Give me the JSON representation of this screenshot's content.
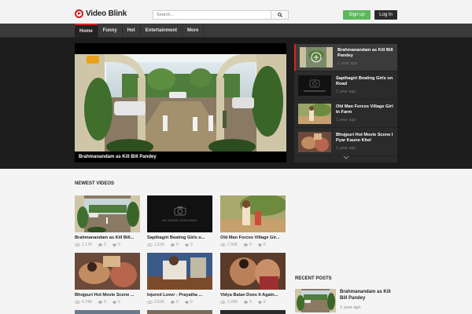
{
  "header": {
    "logo_text": "Video Blink",
    "search_placeholder": "Search...",
    "signup_label": "Sign up",
    "login_label": "Log In"
  },
  "nav": {
    "items": [
      "Home",
      "Funny",
      "Hot",
      "Entertainment",
      "More"
    ]
  },
  "player": {
    "title": "Brahmanandam as Kill Bill Pandey"
  },
  "playlist": {
    "items": [
      {
        "title": "Brahmanandam as Kill Bill Pandey",
        "time": "1 year ago"
      },
      {
        "title": "Sapthagiri Beating Girls on Road",
        "time": "1 year ago"
      },
      {
        "title": "Old Man Forces Village Girl In Farm",
        "time": "1 year ago"
      },
      {
        "title": "Bhojpuri Hot Movie Scene I Pyar Kauno Khel",
        "time": "1 year ago"
      }
    ]
  },
  "newest": {
    "title": "NEWEST VIDEOS",
    "no_image_text": "NO IMAGE AVAILABLE",
    "videos": [
      {
        "title": "Brahmanandam as Kill Bill...",
        "views": "1.17K",
        "comments": "0",
        "likes": "0"
      },
      {
        "title": "Sapthagiri Beating Girls o...",
        "views": "1.61K",
        "comments": "0",
        "likes": "0"
      },
      {
        "title": "Old Man Forces Village Gir...",
        "views": "2.56K",
        "comments": "0",
        "likes": "0"
      },
      {
        "title": "Bhojpuri Hot Movie Scene ...",
        "views": "4.74K",
        "comments": "0",
        "likes": "0"
      },
      {
        "title": "Injured Lover - Prayatha ...",
        "views": "2.52K",
        "comments": "0",
        "likes": "0"
      },
      {
        "title": "Vidya Balan Does It Again...",
        "views": "2.28K",
        "comments": "0",
        "likes": "0"
      }
    ]
  },
  "recent": {
    "title": "RECENT POSTS",
    "items": [
      {
        "title": "Brahmanandam as Kill Bill Pandey",
        "time": "1 year ago"
      }
    ]
  },
  "colors": {
    "accent": "#e02020",
    "signup": "#5cb85c",
    "login": "#2a2a2a",
    "nav": "#3a3a3a",
    "hero": "#1d1d1d"
  }
}
